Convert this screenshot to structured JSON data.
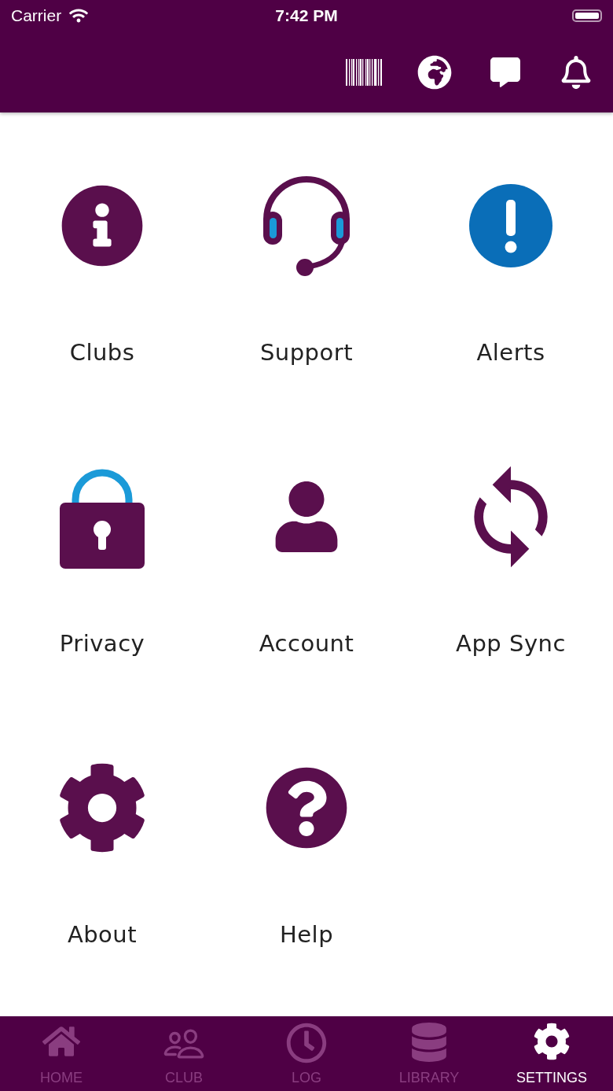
{
  "status_bar": {
    "carrier": "Carrier",
    "time": "7:42 PM"
  },
  "header": {
    "actions": [
      {
        "kind": "barcode"
      },
      {
        "kind": "globe"
      },
      {
        "kind": "chat"
      },
      {
        "kind": "bell"
      }
    ]
  },
  "menu": [
    {
      "kind": "info",
      "label": "Clubs"
    },
    {
      "kind": "headset",
      "label": "Support"
    },
    {
      "kind": "alert",
      "label": "Alerts"
    },
    {
      "kind": "lock",
      "label": "Privacy"
    },
    {
      "kind": "person",
      "label": "Account"
    },
    {
      "kind": "sync",
      "label": "App Sync"
    },
    {
      "kind": "gear",
      "label": "About"
    },
    {
      "kind": "help",
      "label": "Help"
    }
  ],
  "tabs": [
    {
      "kind": "home",
      "label": "HOME",
      "selected": false
    },
    {
      "kind": "club",
      "label": "CLUB",
      "selected": false
    },
    {
      "kind": "log",
      "label": "LOG",
      "selected": false
    },
    {
      "kind": "library",
      "label": "LIBRARY",
      "selected": false
    },
    {
      "kind": "settings",
      "label": "SETTINGS",
      "selected": true
    }
  ]
}
